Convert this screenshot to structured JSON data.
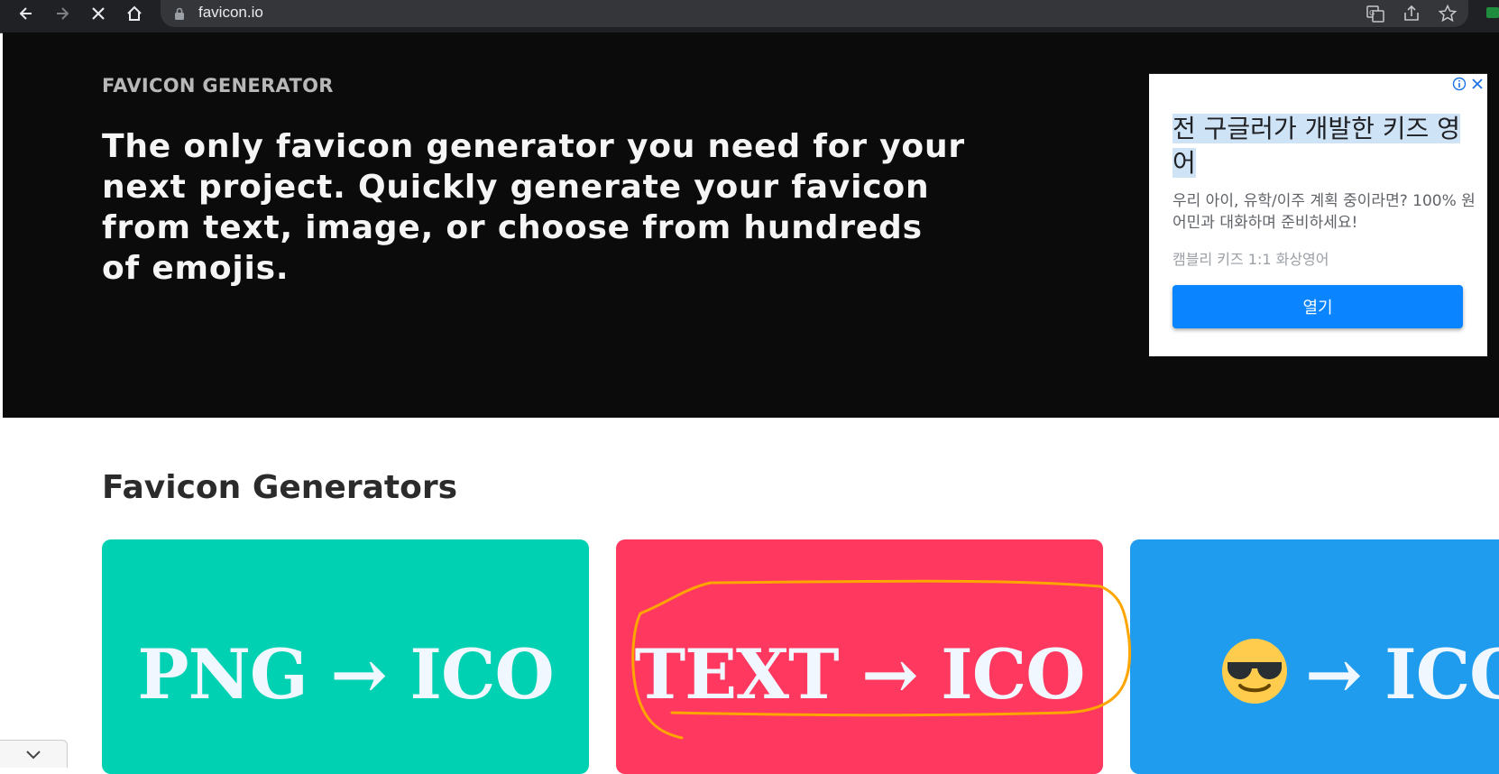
{
  "browser": {
    "url": "favicon.io"
  },
  "hero": {
    "overline": "FAVICON GENERATOR",
    "heading": "The only favicon generator you need for your next project. Quickly generate your favicon from text, image, or choose from hundreds of emojis."
  },
  "ad": {
    "headline": "전 구글러가 개발한 키즈 영어",
    "description": "우리 아이, 유학/이주 계획 중이라면? 100% 원어민과 대화하며 준비하세요!",
    "brand": "캠블리 키즈 1:1 화상영어",
    "button_label": "열기"
  },
  "section": {
    "title": "Favicon Generators"
  },
  "cards": [
    {
      "label": "PNG → ICO",
      "color": "#00d1b2"
    },
    {
      "label": "TEXT → ICO",
      "color": "#ff3860"
    },
    {
      "label": "→ ICO",
      "color": "#209cee",
      "icon": "sunglasses-emoji-icon"
    }
  ],
  "colors": {
    "annotation_stroke": "#ffa500",
    "ad_button": "#0a84ff"
  }
}
